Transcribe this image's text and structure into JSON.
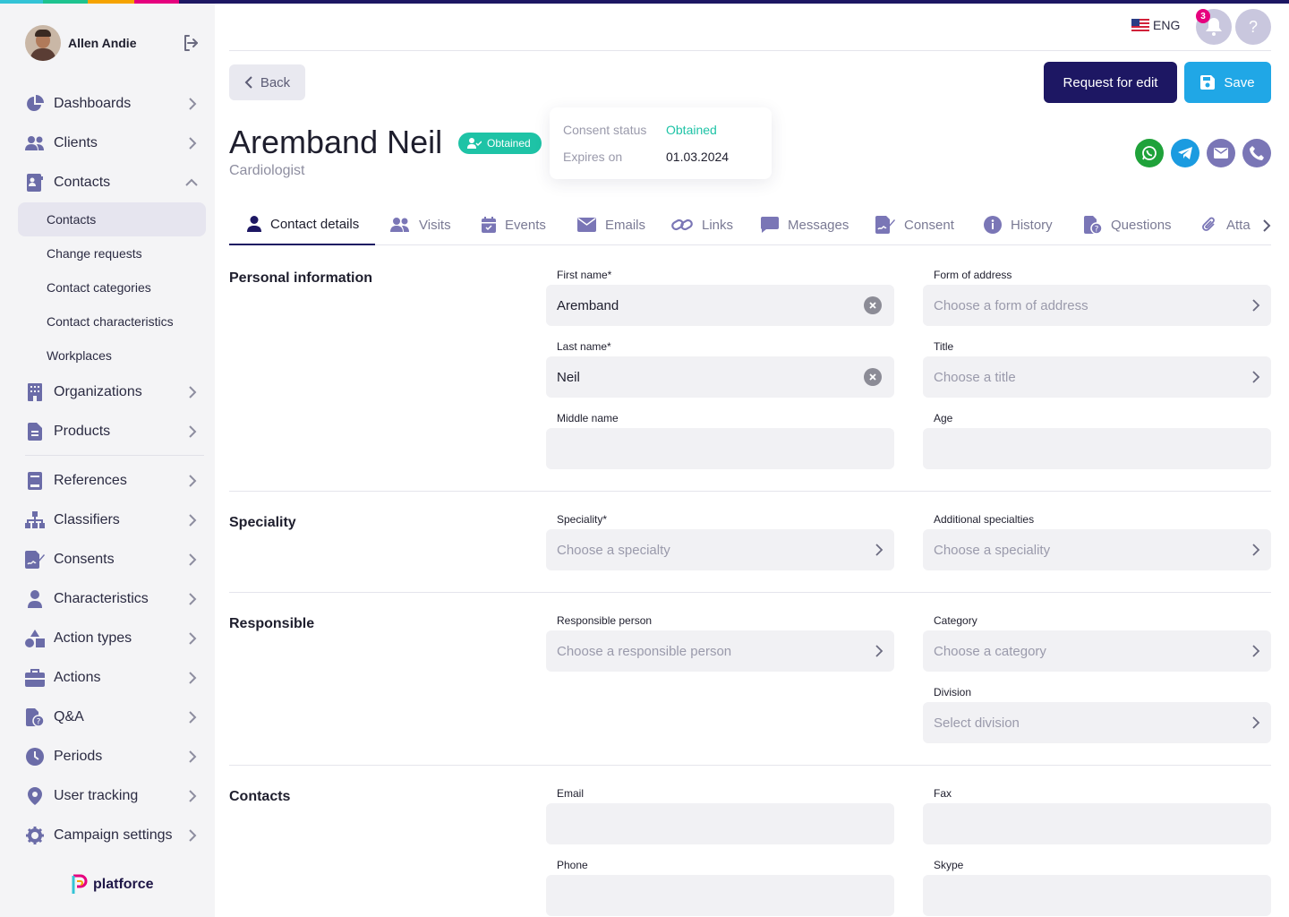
{
  "stripe_colors": [
    "#33c3d6",
    "#1ec38f",
    "#f5a300",
    "#ff5a1f",
    "#e6007e",
    "#1d1763"
  ],
  "user": {
    "name": "Allen Andie"
  },
  "sidebar": {
    "items": [
      {
        "label": "Dashboards",
        "icon": "pie-chart-icon"
      },
      {
        "label": "Clients",
        "icon": "users-icon"
      },
      {
        "label": "Contacts",
        "icon": "contact-card-icon",
        "expanded": true
      }
    ],
    "sub_items": [
      "Contacts",
      "Change requests",
      "Contact categories",
      "Contact characteristics",
      "Workplaces"
    ],
    "items_after": [
      {
        "label": "Organizations",
        "icon": "building-icon"
      },
      {
        "label": "Products",
        "icon": "document-icon"
      }
    ],
    "items_group2": [
      {
        "label": "References",
        "icon": "book-icon"
      },
      {
        "label": "Classifiers",
        "icon": "hierarchy-icon"
      },
      {
        "label": "Consents",
        "icon": "signature-icon"
      },
      {
        "label": "Characteristics",
        "icon": "person-icon"
      },
      {
        "label": "Action types",
        "icon": "shapes-icon"
      },
      {
        "label": "Actions",
        "icon": "briefcase-icon"
      },
      {
        "label": "Q&A",
        "icon": "file-question-icon"
      },
      {
        "label": "Periods",
        "icon": "clock-icon"
      },
      {
        "label": "User tracking",
        "icon": "map-pin-icon"
      },
      {
        "label": "Campaign settings",
        "icon": "gear-icon"
      }
    ]
  },
  "brand": {
    "name": "platforce"
  },
  "header": {
    "language": "ENG",
    "notifications_count": "3",
    "help": "?"
  },
  "toolbar": {
    "back_label": "Back",
    "request_label": "Request for edit",
    "save_label": "Save"
  },
  "contact": {
    "name": "Aremband Neil",
    "status": "Obtained",
    "role": "Cardiologist"
  },
  "consent": {
    "status_label": "Consent status",
    "status_value": "Obtained",
    "expires_label": "Expires on",
    "expires_value": "01.03.2024"
  },
  "tabs": [
    "Contact details",
    "Visits",
    "Events",
    "Emails",
    "Links",
    "Messages",
    "Consent",
    "History",
    "Questions",
    "Atta"
  ],
  "sections": {
    "personal": {
      "title": "Personal information",
      "first_name_label": "First name*",
      "first_name_value": "Aremband",
      "last_name_label": "Last name*",
      "last_name_value": "Neil",
      "middle_name_label": "Middle name",
      "form_address_label": "Form of address",
      "form_address_placeholder": "Choose a form of address",
      "title_label": "Title",
      "title_placeholder": "Choose a title",
      "age_label": "Age"
    },
    "speciality": {
      "title": "Speciality",
      "speciality_label": "Speciality*",
      "speciality_placeholder": "Choose a specialty",
      "additional_label": "Additional specialties",
      "additional_placeholder": "Choose a speciality"
    },
    "responsible": {
      "title": "Responsible",
      "person_label": "Responsible person",
      "person_placeholder": "Choose a responsible person",
      "category_label": "Category",
      "category_placeholder": "Choose a category",
      "division_label": "Division",
      "division_placeholder": "Select division"
    },
    "contacts": {
      "title": "Contacts",
      "email_label": "Email",
      "fax_label": "Fax",
      "phone_label": "Phone",
      "skype_label": "Skype"
    }
  }
}
